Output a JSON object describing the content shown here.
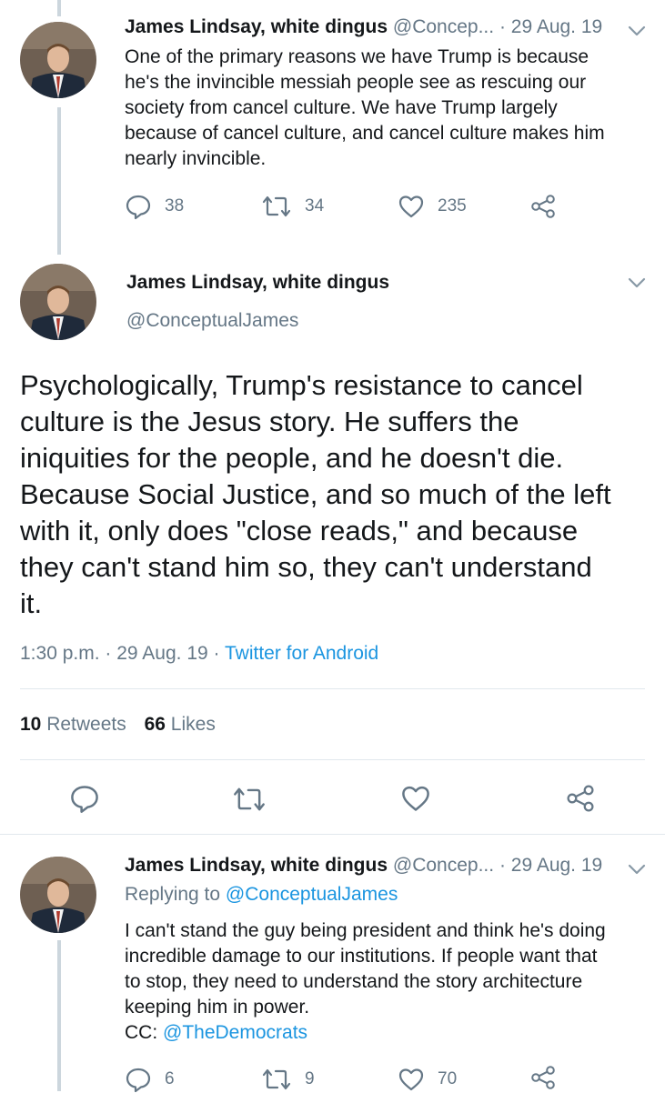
{
  "tweet1": {
    "name": "James Lindsay, white dingus",
    "handle": "@Concep...",
    "sep": "·",
    "date": "29 Aug. 19",
    "lines": [
      "One of the primary reasons we have Trump is because",
      "he's the invincible messiah people see as rescuing our",
      "society from cancel culture. We have Trump largely",
      "because of cancel culture, and cancel culture makes him",
      "nearly invincible."
    ],
    "replies": "38",
    "retweets": "34",
    "likes": "235"
  },
  "tweet2": {
    "name": "James Lindsay, white dingus",
    "handle": "@ConceptualJames",
    "lines": [
      "Psychologically, Trump's resistance to cancel",
      "culture is the Jesus story. He suffers the",
      "iniquities for the people, and he doesn't die.",
      "Because Social Justice, and so much of the left",
      "with it, only does \"close reads,\" and because",
      "they can't stand him so, they can't understand",
      "it."
    ],
    "time": "1:30 p.m.",
    "date": "29 Aug. 19",
    "source": "Twitter for Android",
    "sep": "·",
    "retweet_count": "10",
    "retweet_label": "Retweets",
    "like_count": "66",
    "like_label": "Likes"
  },
  "tweet3": {
    "name": "James Lindsay, white dingus",
    "handle": "@Concep...",
    "sep": "·",
    "date": "29 Aug. 19",
    "replying_label": "Replying to",
    "replying_handle": "@ConceptualJames",
    "lines": [
      "I can't stand the guy being president and think he's doing",
      "incredible damage to our institutions. If people want that",
      "to stop, they need to understand the story architecture",
      "keeping him in power."
    ],
    "cc_label": "CC:",
    "cc_handle": "@TheDemocrats",
    "replies": "6",
    "retweets": "9",
    "likes": "70"
  },
  "colors": {
    "text": "#14171a",
    "muted": "#657786",
    "link": "#1b95e0",
    "thread": "#ccd6dd",
    "divider": "#e1e8ed"
  },
  "icons": [
    "reply-icon",
    "retweet-icon",
    "like-icon",
    "share-icon",
    "chevron-down-icon"
  ]
}
